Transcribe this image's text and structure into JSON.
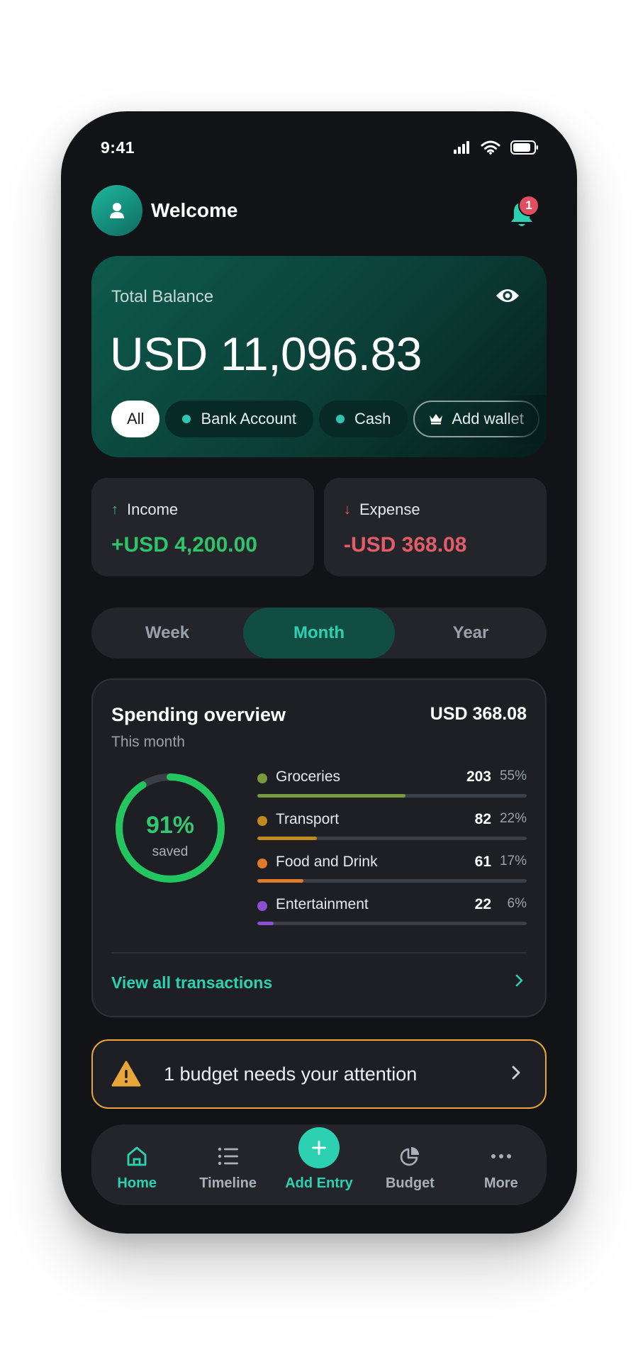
{
  "status_bar": {
    "time": "9:41"
  },
  "header": {
    "welcome": "Welcome",
    "notification_count": "1"
  },
  "balance": {
    "label": "Total Balance",
    "amount": "USD 11,096.83",
    "wallets": [
      "All",
      "Bank Account",
      "Cash",
      "Add wallet"
    ]
  },
  "income": {
    "label": "Income",
    "amount": "+USD 4,200.00"
  },
  "expense": {
    "label": "Expense",
    "amount": "-USD 368.08"
  },
  "periods": [
    "Week",
    "Month",
    "Year"
  ],
  "overview": {
    "title": "Spending overview",
    "total": "USD 368.08",
    "subtitle": "This month",
    "saved_percent_label": "91%",
    "saved_fraction": 0.91,
    "saved_caption": "saved",
    "categories": [
      {
        "name": "Groceries",
        "value": "203",
        "percent": "55%",
        "fraction": 0.55,
        "color": "#7a9a3e"
      },
      {
        "name": "Transport",
        "value": "82",
        "percent": "22%",
        "fraction": 0.22,
        "color": "#c08a1e"
      },
      {
        "name": "Food and Drink",
        "value": "61",
        "percent": "17%",
        "fraction": 0.17,
        "color": "#e07b2a"
      },
      {
        "name": "Entertainment",
        "value": "22",
        "percent": "6%",
        "fraction": 0.06,
        "color": "#8b4fd1"
      }
    ],
    "link": "View all transactions"
  },
  "alert": {
    "text": "1 budget needs your attention"
  },
  "nav": {
    "home": "Home",
    "timeline": "Timeline",
    "add": "Add Entry",
    "budget": "Budget",
    "more": "More"
  },
  "colors": {
    "accent": "#2cd1b2",
    "income": "#2fc36a",
    "expense": "#e35d68",
    "warning": "#e7a53a"
  }
}
